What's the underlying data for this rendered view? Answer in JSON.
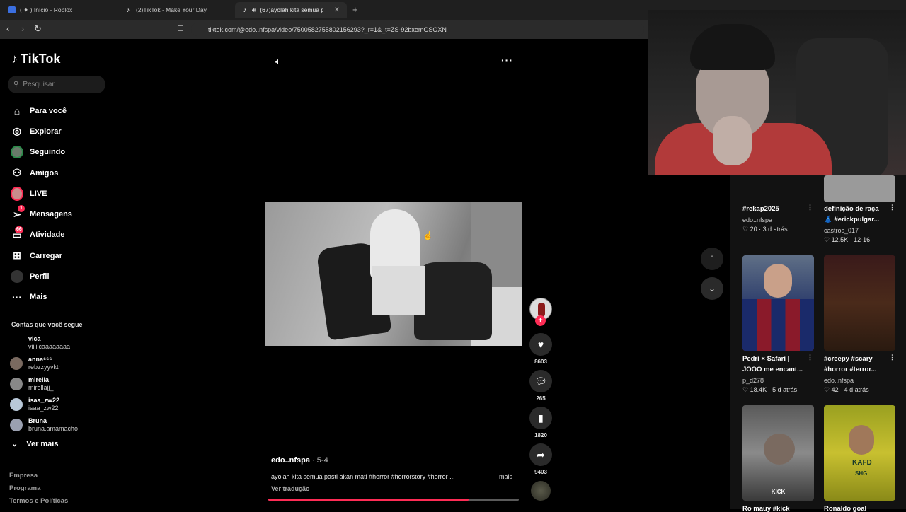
{
  "browser": {
    "tabs": [
      {
        "label": "( ✦ ) Início - Roblox",
        "active": false
      },
      {
        "label": "(2)TikTok - Make Your Day",
        "active": false
      },
      {
        "label": "(67)ayolah kita semua pasti a",
        "active": true
      }
    ],
    "url": "tiktok.com/@edo..nfspa/video/7500582755802156293?_r=1&_t=ZS-92bxemGSOXN"
  },
  "sidebar": {
    "logo_text": "TikTok",
    "search_placeholder": "Pesquisar",
    "nav": [
      {
        "label": "Para você",
        "icon": "home-icon"
      },
      {
        "label": "Explorar",
        "icon": "compass-icon"
      },
      {
        "label": "Seguindo",
        "icon": "avatar"
      },
      {
        "label": "Amigos",
        "icon": "friends-icon"
      },
      {
        "label": "LIVE",
        "icon": "live-avatar"
      },
      {
        "label": "Mensagens",
        "icon": "send-icon",
        "badge": "1"
      },
      {
        "label": "Atividade",
        "icon": "inbox-icon",
        "badge": "66"
      },
      {
        "label": "Carregar",
        "icon": "plus-square-icon"
      },
      {
        "label": "Perfil",
        "icon": "profile-avatar"
      },
      {
        "label": "Mais",
        "icon": "more-icon"
      }
    ],
    "following_title": "Contas que você segue",
    "following": [
      {
        "name": "vica",
        "handle": "viiiiicaaaaaaaa"
      },
      {
        "name": "anna⁶⁶⁶",
        "handle": "rebzzyyvktr"
      },
      {
        "name": "mirella",
        "handle": "mirellajj_"
      },
      {
        "name": "isaa_zw22",
        "handle": "isaa_zw22"
      },
      {
        "name": "Bruna",
        "handle": "bruna.amamacho"
      }
    ],
    "see_more": "Ver mais",
    "footer": [
      "Empresa",
      "Programa",
      "Termos e Políticas"
    ]
  },
  "video": {
    "author": "edo..nfspa",
    "date": " · 5-4",
    "caption": "ayolah kita semua pasti akan mati #horror #horrorstory #horror ...",
    "more": "mais",
    "translate": "Ver tradução",
    "likes": "8603",
    "comments": "265",
    "saves": "1820",
    "shares": "9403",
    "progress_fraction": 0.8,
    "accent_color": "#fe2c55"
  },
  "recommended": [
    {
      "title": "#rekap2025",
      "author": "edo..nfspa",
      "likes": "20",
      "age": "3 d atrás"
    },
    {
      "title": "definição de raça 👗 #erickpulgar...",
      "author": "castros_017",
      "likes": "12.5K",
      "age": "12-16"
    },
    {
      "title": "Pedri × Safari | JOOO me encant...",
      "author": "p_d278",
      "likes": "18.4K",
      "age": "5 d atrás"
    },
    {
      "title": "#creepy #scary #horror #terror...",
      "author": "edo..nfspa",
      "likes": "42",
      "age": "4 d atrás"
    },
    {
      "title": "Ro mauy #kick",
      "author": "",
      "likes": "",
      "age": ""
    },
    {
      "title": "Ronaldo goal",
      "author": "",
      "likes": "",
      "age": ""
    }
  ],
  "thumb_texts": {
    "kick": "KICK",
    "kafd": "KAFD",
    "shg": "SHG"
  }
}
